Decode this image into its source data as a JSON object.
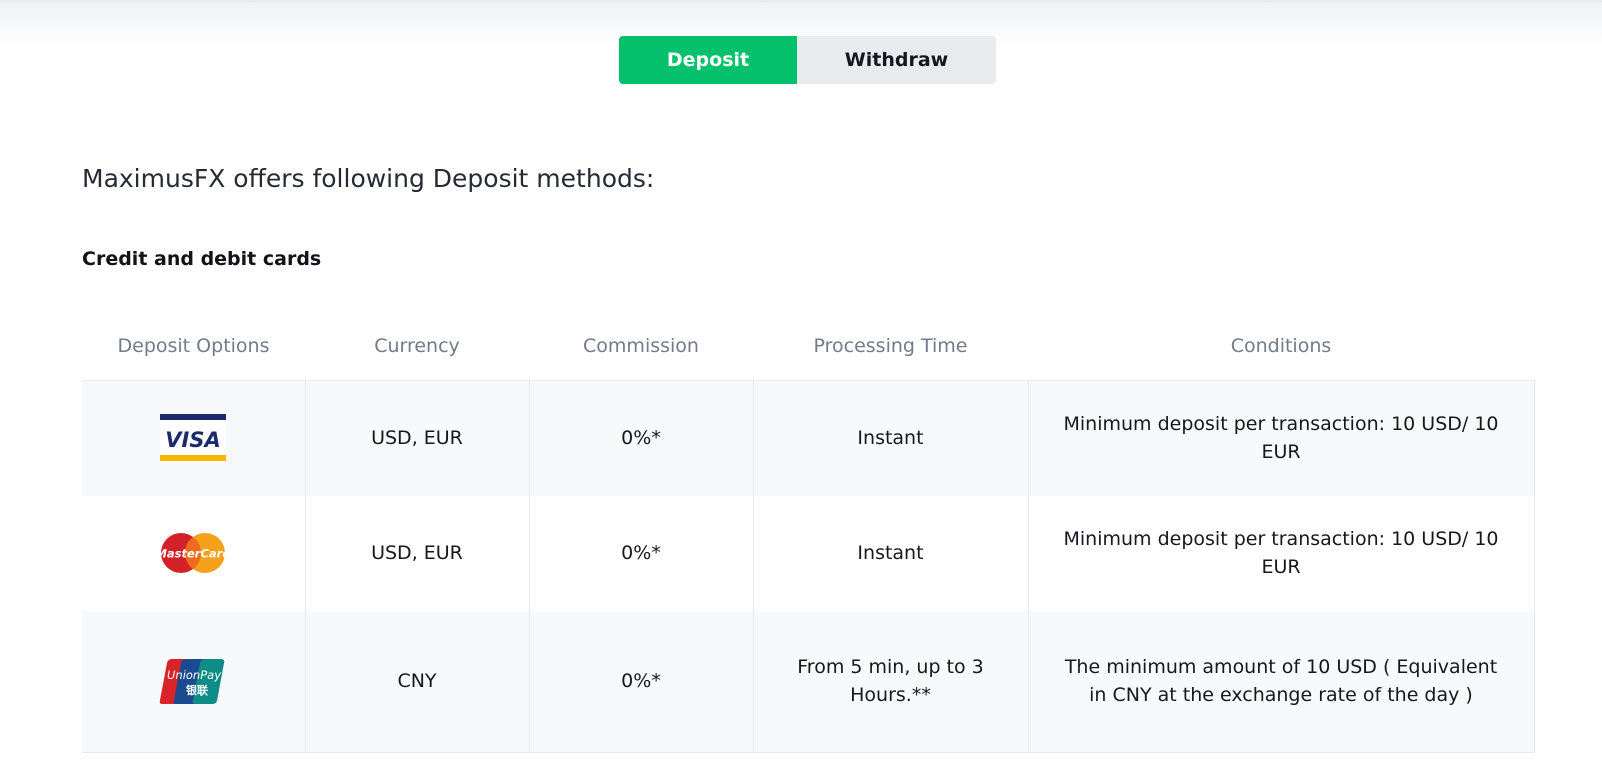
{
  "tabs": [
    {
      "label": "Deposit",
      "active": true
    },
    {
      "label": "Withdraw",
      "active": false
    }
  ],
  "page_heading": "MaximusFX offers following Deposit methods:",
  "section_heading": "Credit and debit cards",
  "table": {
    "headers": [
      "Deposit Options",
      "Currency",
      "Commission",
      "Processing Time",
      "Conditions"
    ],
    "rows": [
      {
        "logo": "visa-logo",
        "currency": "USD, EUR",
        "commission": "0%*",
        "processing_time": "Instant",
        "conditions": "Minimum deposit per transaction: 10 USD/ 10 EUR"
      },
      {
        "logo": "mastercard-logo",
        "currency": "USD, EUR",
        "commission": "0%*",
        "processing_time": "Instant",
        "conditions": "Minimum deposit per transaction: 10 USD/ 10 EUR"
      },
      {
        "logo": "unionpay-logo",
        "currency": "CNY",
        "commission": "0%*",
        "processing_time": "From 5 min, up to 3 Hours.**",
        "conditions": "The minimum amount of 10 USD ( Equivalent in CNY at the exchange rate of the day )"
      }
    ]
  },
  "colors": {
    "accent": "#06c16b",
    "inactive_tab": "#e9ebef",
    "header_text": "#737b88",
    "row_alt": "#f8f9fb"
  },
  "logo_text": {
    "visa": "VISA",
    "mastercard": "MasterCard",
    "unionpay_top": "UnionPay",
    "unionpay_bottom": "银联"
  }
}
